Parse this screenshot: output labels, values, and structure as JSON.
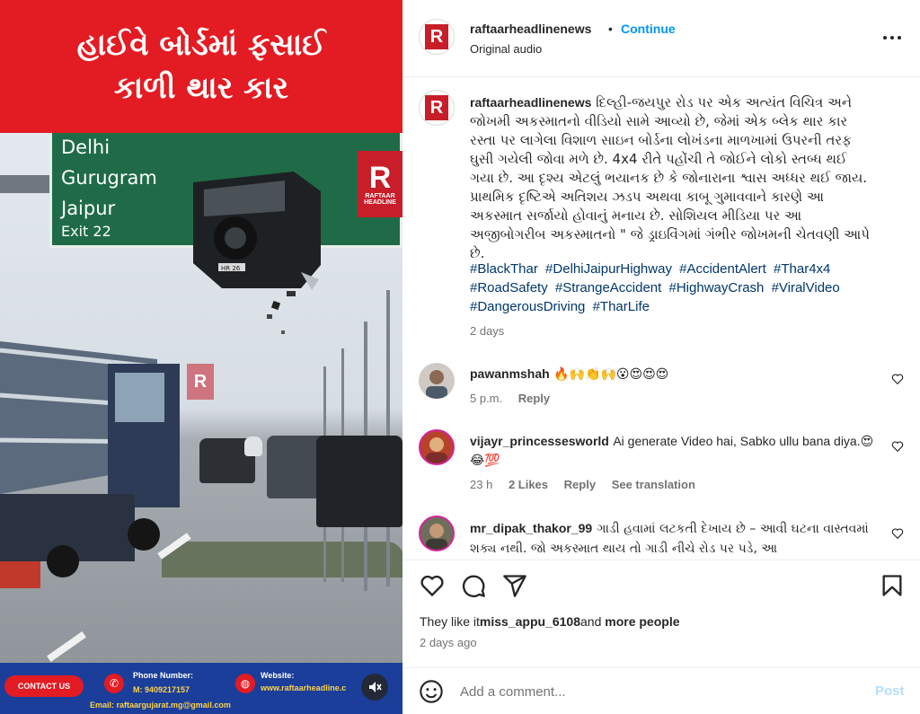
{
  "media": {
    "banner_line1": "હાઈવે બોર્ડમાં ફસાઈ",
    "banner_line2": "કાળી થાર કાર",
    "sign": {
      "dest1": "Delhi",
      "dest2": "Gurugram",
      "dest3": "Jaipur",
      "exit": "Exit 22"
    },
    "logo_letter": "R",
    "logo_word1": "RAFTAAR",
    "logo_word2": "HEADLINE",
    "plate": "HR 26",
    "footer": {
      "contact_label": "CONTACT US",
      "phone_label": "Phone Number:",
      "phone_value": "M: 9409217157",
      "website_label": "Website:",
      "website_value": "www.raftaarheadline.c",
      "email": "Email: raftaargujarat.mg@gmail.com"
    },
    "mute_icon": "speaker-muted-icon"
  },
  "header": {
    "username": "raftaarheadlinenews",
    "separator": "•",
    "continue_label": "Continue",
    "audio": "Original audio",
    "more_icon": "more-horizontal-icon"
  },
  "caption": {
    "username": "raftaarheadlinenews",
    "text": "દિલ્હી-જયપુર રોડ પર એક અત્યંત વિચિત્ર અને જોખમી અકસ્માતનો વીડિયો સામે આવ્યો છે, જેમાં એક બ્લેક થાર કાર રસ્તા પર લાગેલા વિશાળ સાઇન બોર્ડના લોખંડના માળખામાં ઉપરની તરફ ઘુસી ગયેલી જોવા મળે છે. 4x4 રીતે પહોંચી તે જોઈને લોકો સ્તબ્ધ થઈ ગયા છે. આ દૃશ્ય એટલું ભયાનક છે કે જોનારાના શ્વાસ અધ્ધર થઈ જાય. પ્રાથમિક દૃષ્ટિએ અતિશય ઝડપ અથવા કાબૂ ગુમાવવાને કારણે આ અકસ્માત સર્જાયો હોવાનું મનાય છે. સોશિયલ મીડિયા પર આ અજીબોગરીબ અકસ્માતનો \" જે ડ્રાઇવિંગમાં ગંભીર જોખમની ચેતવણી આપે છે.",
    "hashtags": [
      "#BlackThar",
      "#DelhiJaipurHighway",
      "#AccidentAlert",
      "#Thar4x4",
      "#RoadSafety",
      "#StrangeAccident",
      "#HighwayCrash",
      "#ViralVideo",
      "#DangerousDriving",
      "#TharLife"
    ],
    "time": "2 days"
  },
  "comments": [
    {
      "username": "pawanmshah",
      "text": "🔥🙌👏🙌😮😍😍😍",
      "time": "5 p.m.",
      "likes": "",
      "reply": "Reply",
      "translate": ""
    },
    {
      "username": "vijayr_princessesworld",
      "text": "Ai generate Video hai, Sabko ullu bana diya.😍😂💯",
      "time": "23 h",
      "likes": "2 Likes",
      "reply": "Reply",
      "translate": "See translation"
    },
    {
      "username": "mr_dipak_thakor_99",
      "text": "ગાડી હવામાં લટકતી દેખાય છે – આવી ઘટના વાસ્તવમાં શક્ય નથી. જો અકસ્માત થાય તો ગાડી નીચે રોડ પર પડે, આ",
      "time": "",
      "likes": "",
      "reply": "",
      "translate": ""
    }
  ],
  "actions": {
    "like_icon": "heart-icon",
    "comment_icon": "comment-icon",
    "share_icon": "share-icon",
    "save_icon": "bookmark-icon",
    "likes_prefix": "They like it",
    "likes_user": "miss_appu_6108",
    "likes_and": "and",
    "likes_suffix": "more people",
    "posted": "2 days ago"
  },
  "add_comment": {
    "emoji_icon": "emoji-icon",
    "placeholder": "Add a comment...",
    "post_label": "Post"
  },
  "colors": {
    "banner": "#e31b23",
    "sign": "#1f6b47",
    "link": "#0095f6",
    "hashtag": "#00376b",
    "footer": "#1a3e9a"
  }
}
